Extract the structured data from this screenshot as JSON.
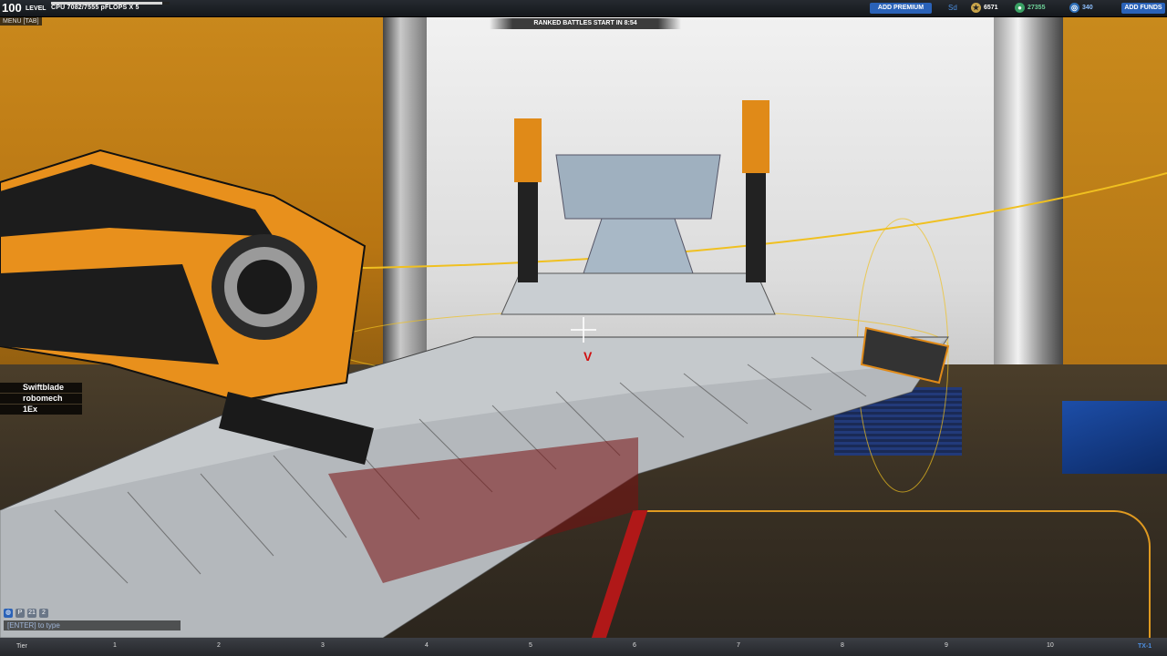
{
  "hud": {
    "level_value": "100",
    "level_label": "LEVEL",
    "cpu_text": "CPU 7082/7555 pFLOPS X 5",
    "cpu_fraction": 0.94,
    "menu_tag": "MENU [TAB]",
    "banner": "RANKED BATTLES START IN 8:54",
    "add_premium": "ADD PREMIUM",
    "sd": "Sd",
    "currency_1": "6571",
    "currency_2": "27355",
    "currency_3": "340",
    "add_funds": "ADD FUNDS"
  },
  "players": [
    "Swiftblade",
    "robomech",
    "1Ex"
  ],
  "chat": {
    "icons": [
      "P",
      "21",
      "2"
    ],
    "placeholder": "[ENTER] to type"
  },
  "tier_ruler": {
    "label": "Tier",
    "ticks": [
      "1",
      "2",
      "3",
      "4",
      "5",
      "6",
      "7",
      "8",
      "9",
      "10"
    ],
    "right_label": "TX-1"
  },
  "colors": {
    "accent_blue": "#2a62b8",
    "hud_dark": "#14171b",
    "wall_orange": "#c9881c"
  }
}
